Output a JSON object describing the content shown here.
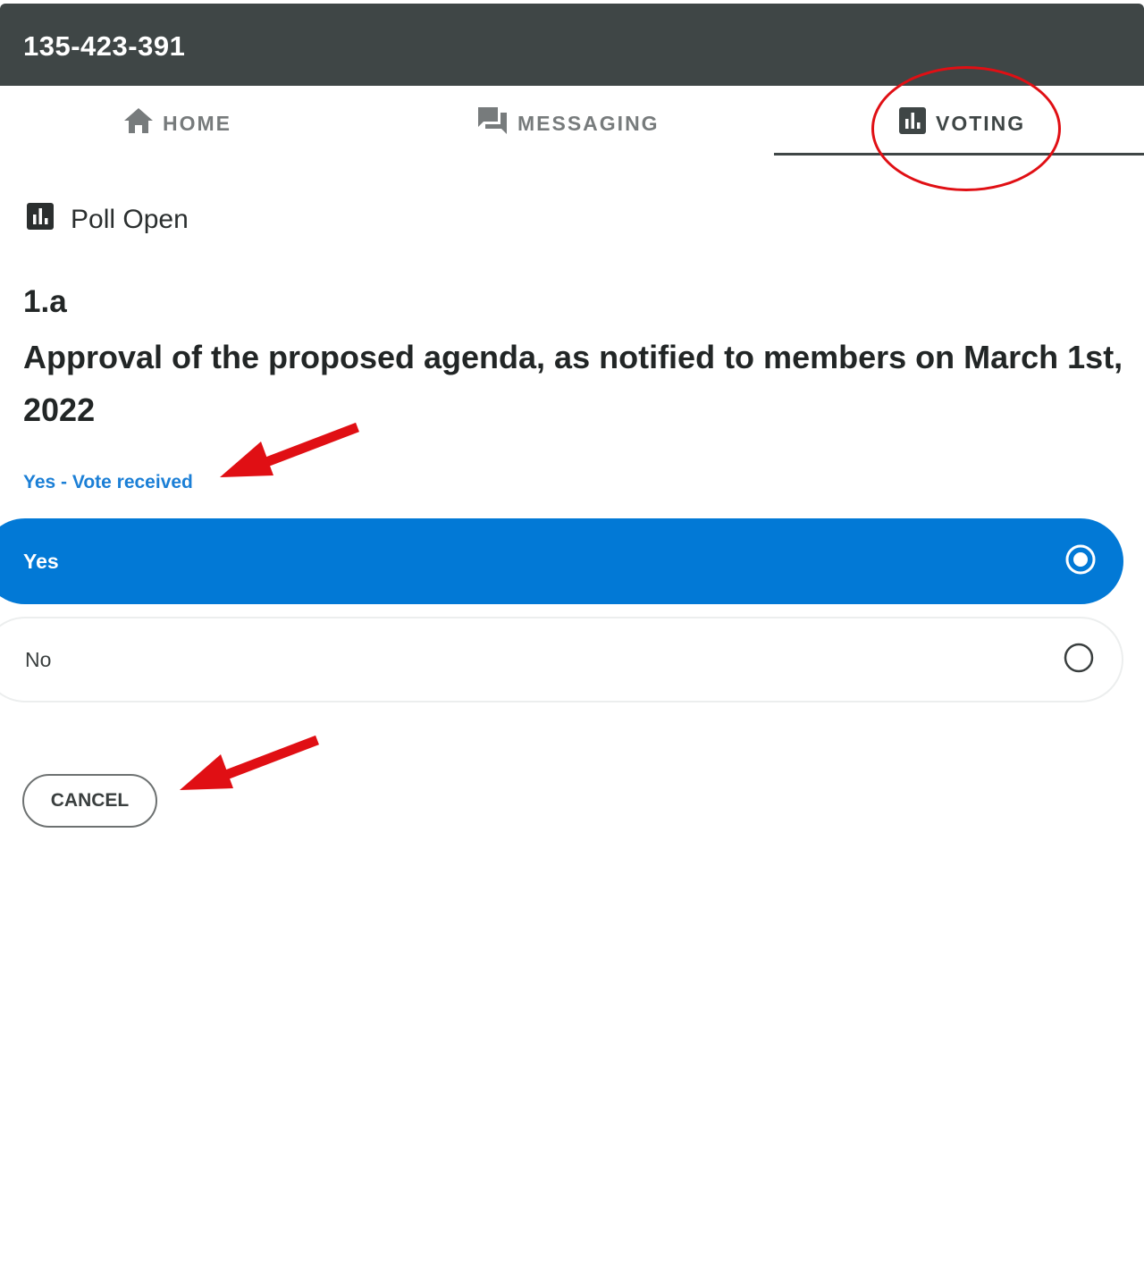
{
  "header": {
    "meeting_id": "135-423-391"
  },
  "tabs": [
    {
      "label": "HOME",
      "icon": "home-icon"
    },
    {
      "label": "MESSAGING",
      "icon": "chat-icon"
    },
    {
      "label": "VOTING",
      "icon": "poll-icon",
      "active": true
    }
  ],
  "poll": {
    "status": "Poll Open",
    "status_icon": "poll-icon",
    "number": "1.a",
    "question": "Approval of the proposed agenda, as notified to members on March 1st, 2022",
    "vote_status": "Yes - Vote received",
    "options": [
      {
        "label": "Yes",
        "selected": true
      },
      {
        "label": "No",
        "selected": false
      }
    ],
    "cancel_label": "CANCEL"
  },
  "colors": {
    "header_bg": "#3f4646",
    "accent_blue": "#0279d6",
    "vote_status_blue": "#1b7fd6",
    "annotation_red": "#e00f14"
  }
}
